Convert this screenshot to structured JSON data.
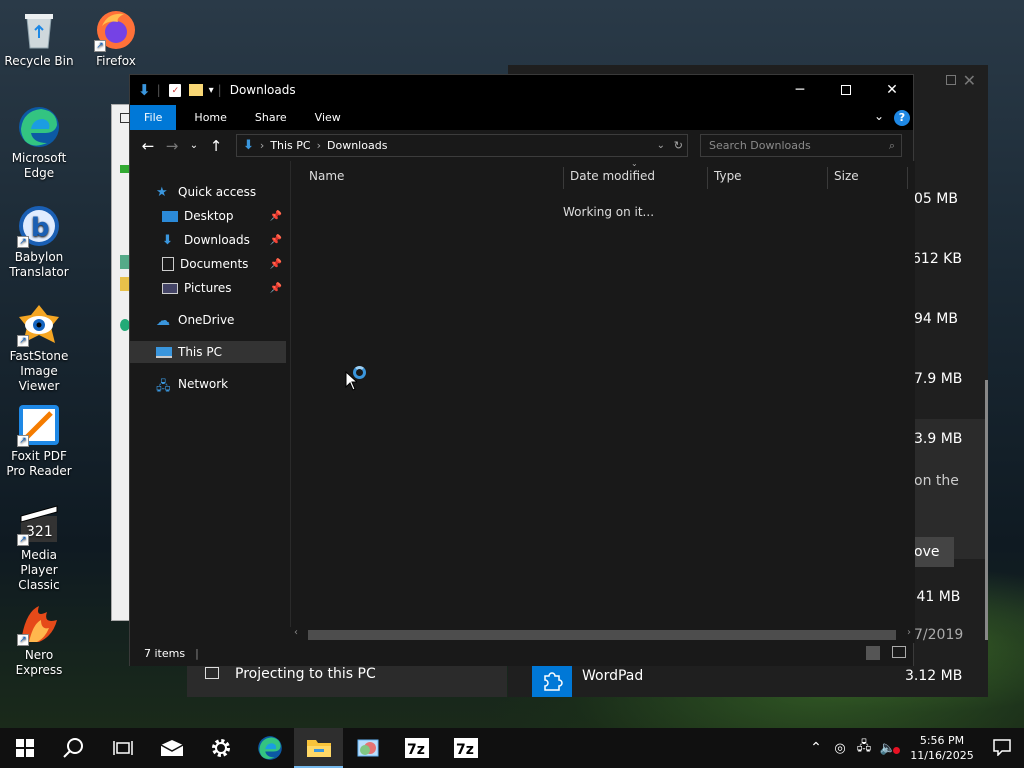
{
  "desktop": {
    "icons": [
      {
        "label": "Recycle Bin",
        "icon": "recycle-bin-icon"
      },
      {
        "label": "Firefox",
        "icon": "firefox-icon"
      },
      {
        "label": "Microsoft Edge",
        "icon": "edge-icon"
      },
      {
        "label": "Babylon Translator",
        "icon": "babylon-icon"
      },
      {
        "label": "FastStone Image Viewer",
        "icon": "faststone-icon"
      },
      {
        "label": "Foxit PDF Pro Reader",
        "icon": "foxit-icon"
      },
      {
        "label": "Media Player Classic",
        "icon": "media-player-icon"
      },
      {
        "label": "Nero Express",
        "icon": "nero-icon"
      }
    ]
  },
  "background_window": {
    "sizes": [
      "05 MB",
      "612 KB",
      "94 MB",
      "7.9 MB",
      "3.9 MB",
      ".41 MB"
    ],
    "partial_text": "on the",
    "button_partial": "ove",
    "date_partial": "7/2019",
    "app_name": "WordPad",
    "app_size": "3.12 MB"
  },
  "settings_window": {
    "item": "Projecting to this PC"
  },
  "explorer": {
    "title": "Downloads",
    "ribbon_tabs": [
      "File",
      "Home",
      "Share",
      "View"
    ],
    "breadcrumb": [
      "This PC",
      "Downloads"
    ],
    "search_placeholder": "Search Downloads",
    "nav": {
      "quick_access": "Quick access",
      "desktop": "Desktop",
      "downloads": "Downloads",
      "documents": "Documents",
      "pictures": "Pictures",
      "onedrive": "OneDrive",
      "this_pc": "This PC",
      "network": "Network"
    },
    "columns": {
      "name": "Name",
      "date": "Date modified",
      "type": "Type",
      "size": "Size"
    },
    "loading_text": "Working on it...",
    "status": "7 items"
  },
  "taskbar": {
    "time": "5:56 PM",
    "date": "11/16/2025"
  },
  "colors": {
    "accent": "#0078d7",
    "explorer_bg": "#191919",
    "titlebar": "#000000"
  }
}
